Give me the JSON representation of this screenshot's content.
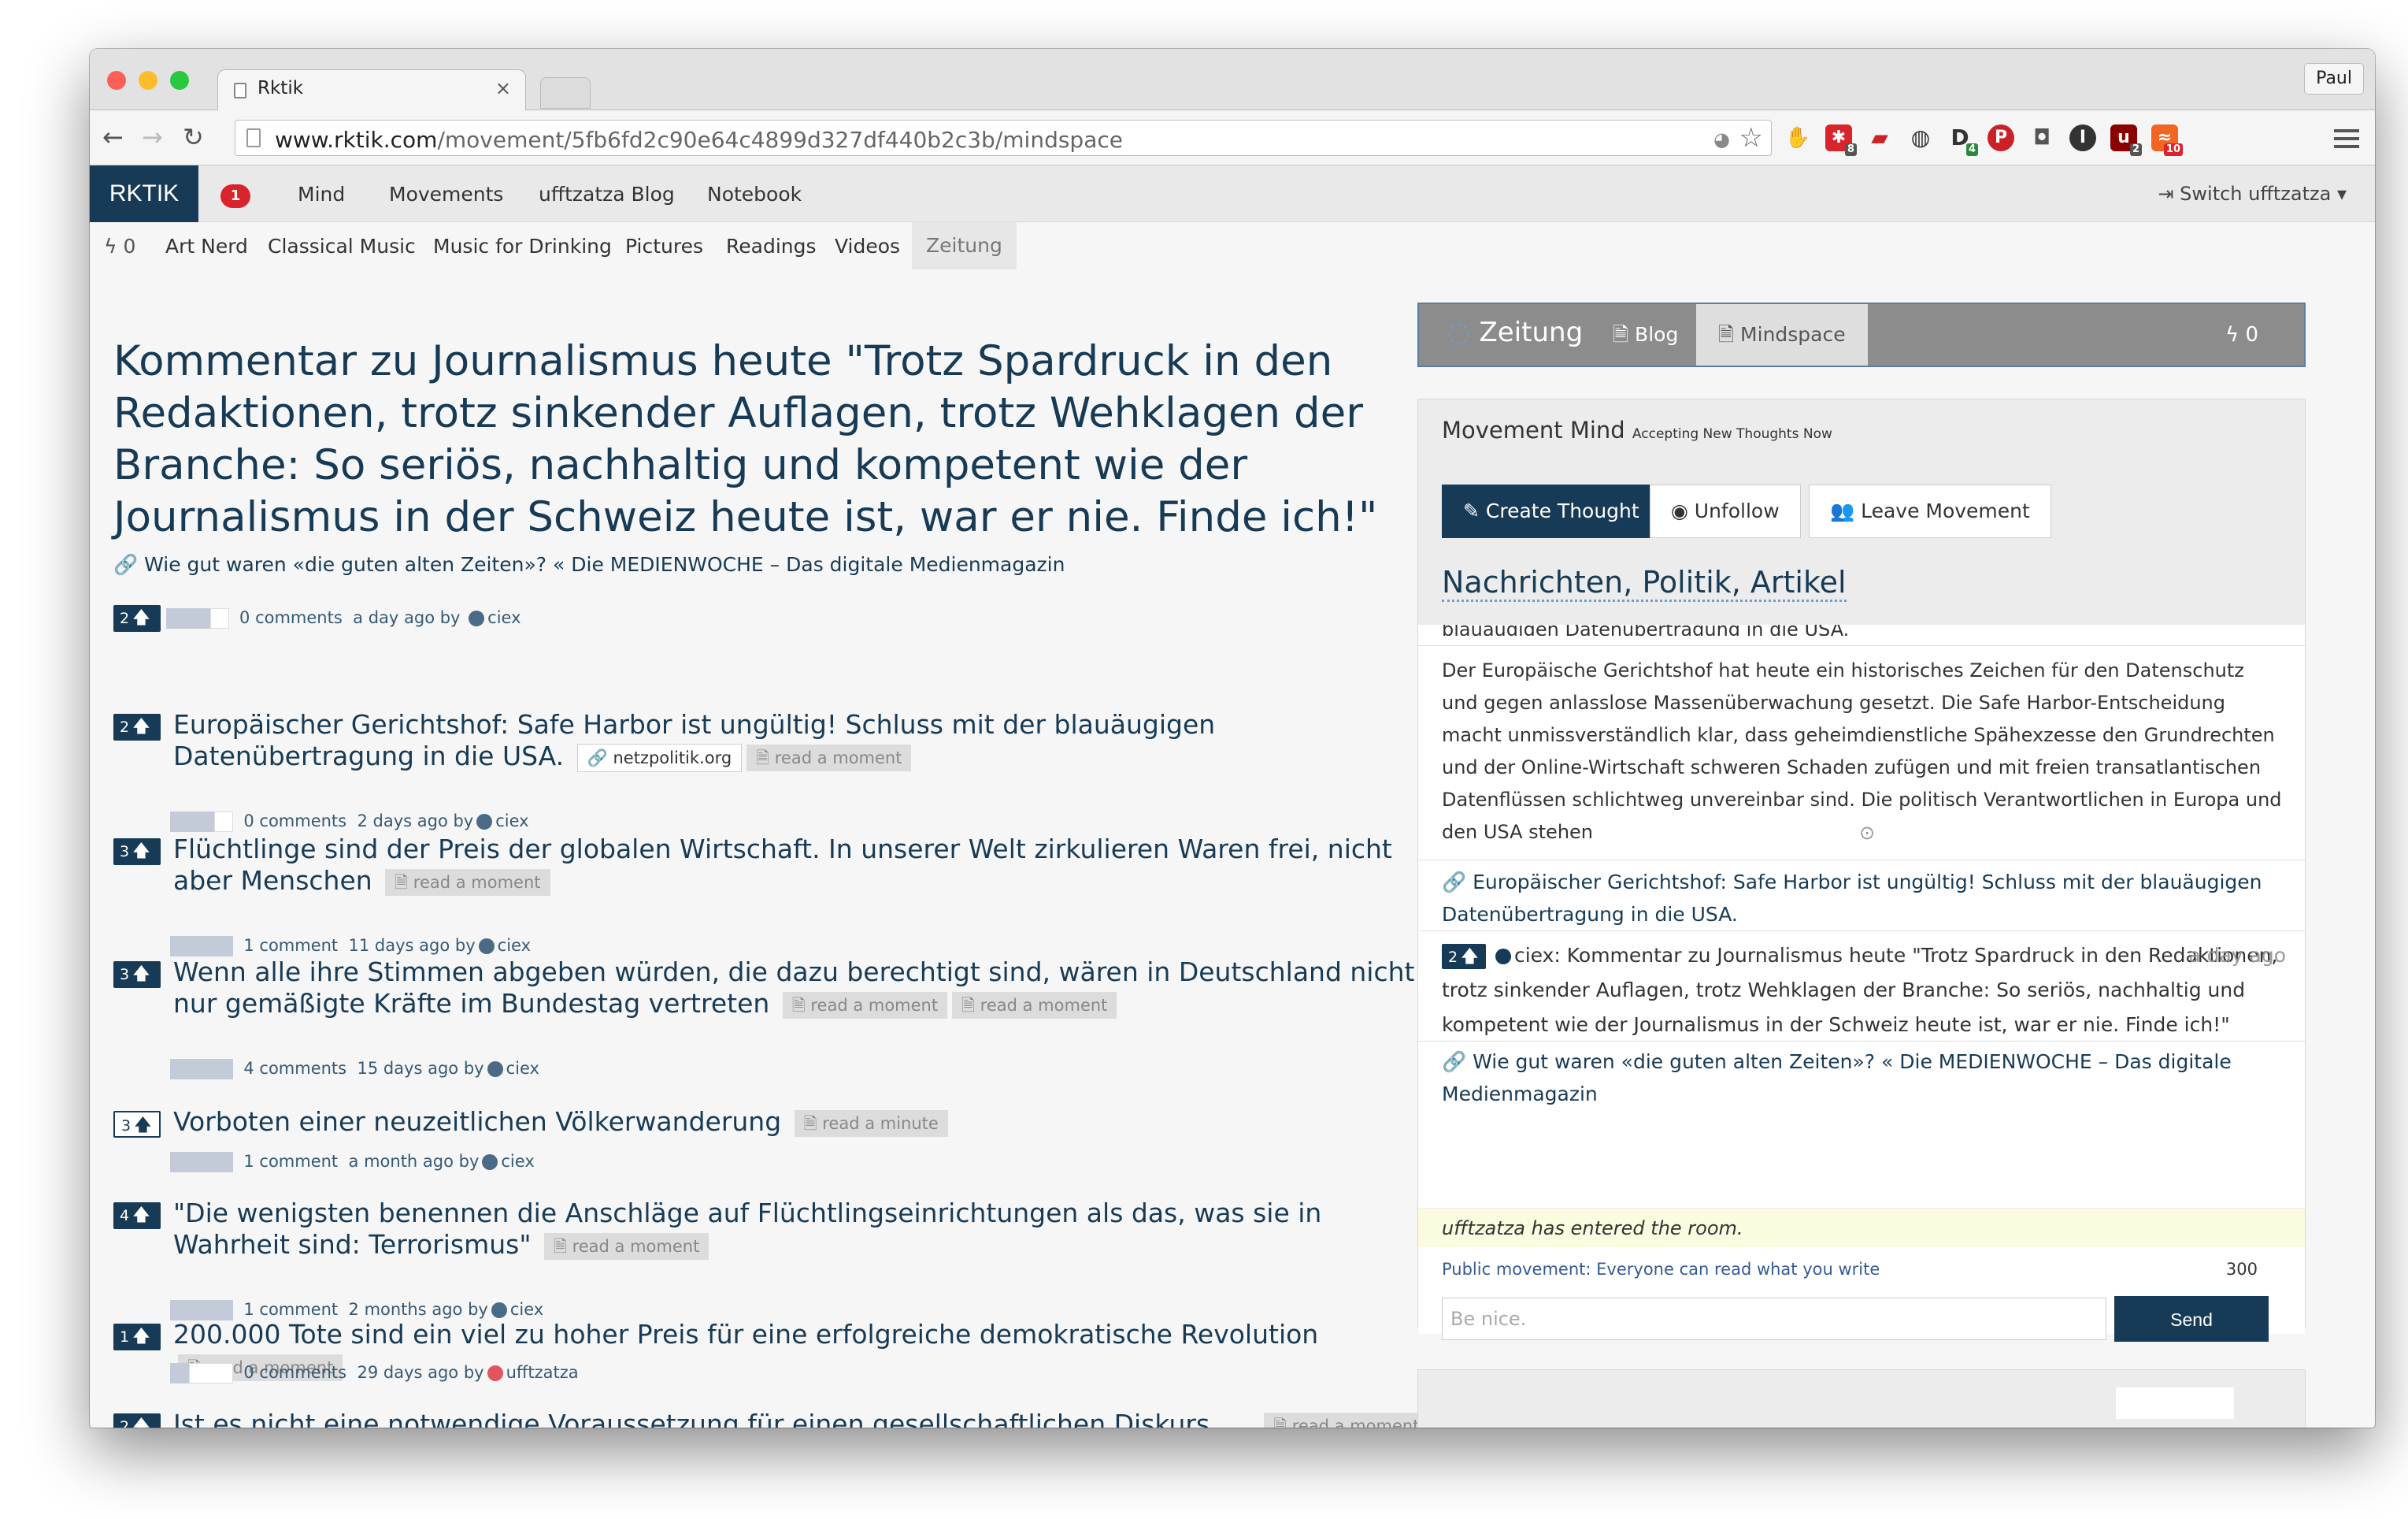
{
  "browser": {
    "tab_title": "Rktik",
    "tab_close": "×",
    "user": "Paul",
    "url_domain": "www.rktik.com",
    "url_path": "/movement/5fb6fd2c90e64c4899d327df440b2c3b/mindspace",
    "ext_badges": [
      "8",
      "4",
      "2",
      "10"
    ]
  },
  "nav": {
    "brand": "RKTIK",
    "notif_count": "1",
    "links": [
      "Mind",
      "Movements",
      "ufftzatza Blog",
      "Notebook"
    ],
    "switch": "Switch ufftzatza"
  },
  "subnav": {
    "count": "0",
    "links": [
      "Art Nerd",
      "Classical Music",
      "Music for Drinking",
      "Pictures",
      "Readings",
      "Videos",
      "Zeitung"
    ]
  },
  "article": {
    "title": "Kommentar zu Journalismus heute \"Trotz Spardruck in den Redaktionen, trotz sinkender Auflagen, trotz Wehklagen der Branche: So seriös, nachhaltig und kompetent wie der Journalismus in der Schweiz heute ist, war er nie. Finde ich!\"",
    "link": "Wie gut waren «die guten alten Zeiten»? « Die MEDIENWOCHE – Das digitale Medienmagazin",
    "votes": "2",
    "comments": "0 comments",
    "time": "a day ago by",
    "author": "ciex"
  },
  "items": [
    {
      "votes": "2",
      "title": "Europäischer Gerichtshof: Safe Harbor ist ungültig! Schluss mit der blauäugigen Datenübertragung in die USA.",
      "source": "netzpolitik.org",
      "tags": [
        "read a moment"
      ],
      "comments": "0 comments",
      "time": "2 days ago by",
      "author": "ciex"
    },
    {
      "votes": "3",
      "title": "Flüchtlinge sind der Preis der globalen Wirtschaft. In unserer Welt zirkulieren Waren frei, nicht aber Menschen",
      "tags": [
        "read a moment"
      ],
      "comments": "1 comment",
      "time": "11 days ago by",
      "author": "ciex"
    },
    {
      "votes": "3",
      "title": "Wenn alle ihre Stimmen abgeben würden, die dazu berechtigt sind, wären in Deutschland nicht nur gemäßigte Kräfte im Bundestag vertreten",
      "tags": [
        "read a moment",
        "read a moment"
      ],
      "comments": "4 comments",
      "time": "15 days ago by",
      "author": "ciex"
    },
    {
      "votes": "3",
      "title": "Vorboten einer neuzeitlichen Völkerwanderung",
      "tags": [
        "read a minute"
      ],
      "comments": "1 comment",
      "time": "a month ago by",
      "author": "ciex"
    },
    {
      "votes": "4",
      "title": "\"Die wenigsten benennen die Anschläge auf Flüchtlingseinrichtungen als das, was sie in Wahrheit sind: Terrorismus\"",
      "tags": [
        "read a moment"
      ],
      "comments": "1 comment",
      "time": "2 months ago by",
      "author": "ciex"
    },
    {
      "votes": "1",
      "title": "200.000 Tote sind ein viel zu hoher Preis für eine erfolgreiche demokratische Revolution",
      "tags": [
        "read a moment"
      ],
      "comments": "0 comments",
      "time": "29 days ago by",
      "author": "ufftzatza"
    },
    {
      "votes": "2",
      "title": "Ist es nicht eine notwendige Voraussetzung für einen gesellschaftlichen Diskurs, ...",
      "tags": [
        "read a moment"
      ]
    }
  ],
  "sidebar": {
    "movement": "Zeitung",
    "tabs": [
      "Blog",
      "Mindspace"
    ],
    "count": "0",
    "mind_title": "Movement Mind",
    "mind_sub": "Accepting New Thoughts Now",
    "buttons": [
      "Create Thought",
      "Unfollow",
      "Leave Movement"
    ],
    "topic": "Nachrichten, Politik, Artikel",
    "cut_line": "blauäugigen Datenübertragung in die USA.",
    "text": "Der Europäische Gerichtshof hat heute ein historisches Zeichen für den Datenschutz und gegen anlasslose Massenüberwachung gesetzt. Die Safe Harbor-Entscheidung macht unmissverständlich klar, dass geheimdienstliche Spähexzesse den Grundrechten und der Online-Wirtschaft schweren Schaden zufügen und mit freien transatlantischen Datenflüssen schlichtweg unvereinbar sind. Die politisch Verantwortlichen in Europa und den USA stehen",
    "link1": "Europäischer Gerichtshof: Safe Harbor ist ungültig! Schluss mit der blauäugigen Datenübertragung in die USA.",
    "chat_votes": "2",
    "chat_text": "ciex: Kommentar zu Journalismus heute \"Trotz Spardruck in den Redaktionen, trotz sinkender Auflagen, trotz Wehklagen der Branche: So seriös, nachhaltig und kompetent wie der Journalismus in der Schweiz heute ist, war er nie. Finde ich!\"",
    "chat_time": "a day ago",
    "link2": "Wie gut waren «die guten alten Zeiten»? « Die MEDIENWOCHE – Das digitale Medienmagazin",
    "entered": "ufftzatza has entered the room.",
    "public_label": "Public movement: Everyone can read what you write",
    "char_count": "300",
    "placeholder": "Be nice.",
    "send": "Send"
  },
  "colors": {
    "primary": "#173b56",
    "badge": "#d9242b",
    "highlight": "#fbfbe0"
  }
}
